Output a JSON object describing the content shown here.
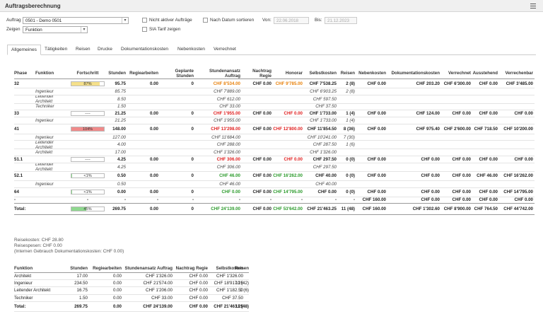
{
  "window": {
    "title": "Auftragsberechnung",
    "menu_icon": "hamburger-icon"
  },
  "filters": {
    "auftrag_label": "Auftrag",
    "auftrag_value": "0501 - Demo 0501",
    "zeigen_label": "Zeigen",
    "zeigen_value": "Funktion",
    "nicht_aktiver_label": "Nicht aktiver Aufträge",
    "sia_tarif_label": "SIA Tarif zeigen",
    "nach_datum_label": "Nach Datum sortieren",
    "von_label": "Von:",
    "von_value": "22.06.2018",
    "bis_label": "Bis:",
    "bis_value": "21.12.2023"
  },
  "tabs": [
    "Allgemeines",
    "Tätigkeiten",
    "Reisen",
    "Drucke",
    "Dokumentationskosten",
    "Nebenkosten",
    "Verrechnet"
  ],
  "main_table": {
    "headers": [
      "Phase",
      "Funktion",
      "Fortschritt",
      "Stunden",
      "Regiearbeiten",
      "Geplante Stunden",
      "Stundenansatz Auftrag",
      "Nachtrag Regie",
      "Honorar",
      "Selbstkosten",
      "Reisen",
      "Nebenkosten",
      "Dokumentationskosten",
      "Verrechnet",
      "Ausstehend",
      "Verrechenbar"
    ],
    "rows": [
      {
        "type": "phase",
        "phase": "32",
        "progress_label": "87%",
        "progress": 0.87,
        "bar_color": "#f5e08a",
        "stunden": "95.75",
        "regie": "0.00",
        "geplant": "0",
        "ansatz": "CHF 8'534.00",
        "ansatz_color": "orange",
        "nachtrag": "CHF 0.00",
        "honorar": "CHF 9'785.00",
        "honorar_color": "orange",
        "selbst": "CHF 7'538.25",
        "reisen": "2 (8)",
        "neben": "CHF 0.00",
        "doku": "CHF 203.20",
        "verr": "CHF 6'300.00",
        "aus": "CHF 0.00",
        "verrb": "CHF 3'485.00",
        "verrb_color": ""
      },
      {
        "type": "sub",
        "funktion": "Ingenieur",
        "stunden": "85.75",
        "ansatz": "CHF 7'889.00",
        "selbst": "CHF 6'903.25",
        "reisen": "2 (8)"
      },
      {
        "type": "sub",
        "funktion": "Leitender Architekt",
        "stunden": "8.50",
        "ansatz": "CHF 612.00",
        "selbst": "CHF 597.50",
        "reisen": ""
      },
      {
        "type": "sub",
        "funktion": "Techniker",
        "stunden": "1.50",
        "ansatz": "CHF 33.00",
        "selbst": "CHF 37.50",
        "reisen": ""
      },
      {
        "type": "phase",
        "phase": "33",
        "progress_label": "----",
        "progress": 0,
        "bar_color": "#ffffff",
        "stunden": "21.25",
        "regie": "0.00",
        "geplant": "0",
        "ansatz": "CHF 1'955.00",
        "ansatz_color": "red",
        "nachtrag": "CHF 0.00",
        "honorar": "CHF 0.00",
        "honorar_color": "red",
        "selbst": "CHF 1'733.00",
        "reisen": "1 (4)",
        "neben": "CHF 0.00",
        "doku": "CHF 124.00",
        "verr": "CHF 0.00",
        "aus": "CHF 0.00",
        "verrb": "CHF 0.00",
        "verrb_color": ""
      },
      {
        "type": "sub",
        "funktion": "Ingenieur",
        "stunden": "21.25",
        "ansatz": "CHF 1'955.00",
        "selbst": "CHF 1'733.00",
        "reisen": "1 (4)"
      },
      {
        "type": "phase",
        "phase": "41",
        "progress_label": "104%",
        "progress": 1,
        "bar_color": "#f08a8a",
        "stunden": "148.00",
        "regie": "0.00",
        "geplant": "0",
        "ansatz": "CHF 13'298.00",
        "ansatz_color": "red",
        "nachtrag": "CHF 0.00",
        "honorar": "CHF 12'800.00",
        "honorar_color": "red",
        "selbst": "CHF 11'854.50",
        "reisen": "8 (36)",
        "neben": "CHF 0.00",
        "doku": "CHF 975.40",
        "verr": "CHF 2'600.00",
        "aus": "CHF 718.50",
        "verrb": "CHF 10'200.00",
        "verrb_color": ""
      },
      {
        "type": "sub",
        "funktion": "Ingenieur",
        "stunden": "127.00",
        "ansatz": "CHF 11'684.00",
        "selbst": "CHF 10'241.00",
        "reisen": "7 (30)"
      },
      {
        "type": "sub",
        "funktion": "Leitender Architekt",
        "stunden": "4.00",
        "ansatz": "CHF 288.00",
        "selbst": "CHF 287.50",
        "reisen": "1 (6)"
      },
      {
        "type": "sub",
        "funktion": "Architekt",
        "stunden": "17.00",
        "ansatz": "CHF 1'326.00",
        "selbst": "CHF 1'326.00",
        "reisen": ""
      },
      {
        "type": "phase",
        "phase": "51.1",
        "progress_label": "----",
        "progress": 0,
        "bar_color": "#ffffff",
        "stunden": "4.25",
        "regie": "0.00",
        "geplant": "0",
        "ansatz": "CHF 306.00",
        "ansatz_color": "red",
        "nachtrag": "CHF 0.00",
        "honorar": "CHF 0.00",
        "honorar_color": "red",
        "selbst": "CHF 297.50",
        "reisen": "0 (0)",
        "neben": "CHF 0.00",
        "doku": "CHF 0.00",
        "verr": "CHF 0.00",
        "aus": "CHF 0.00",
        "verrb": "CHF 0.00",
        "verrb_color": ""
      },
      {
        "type": "sub",
        "funktion": "Leitender Architekt",
        "stunden": "4.25",
        "ansatz": "CHF 306.00",
        "selbst": "CHF 297.50",
        "reisen": ""
      },
      {
        "type": "phase",
        "phase": "52.1",
        "progress_label": "<1%",
        "progress": 0.01,
        "bar_color": "#8fd88f",
        "stunden": "0.50",
        "regie": "0.00",
        "geplant": "0",
        "ansatz": "CHF 46.00",
        "ansatz_color": "green",
        "nachtrag": "CHF 0.00",
        "honorar": "CHF 16'262.00",
        "honorar_color": "green",
        "selbst": "CHF 40.00",
        "reisen": "0 (0)",
        "neben": "CHF 0.00",
        "doku": "CHF 0.00",
        "verr": "CHF 0.00",
        "aus": "CHF 46.00",
        "verrb": "CHF 16'262.00",
        "verrb_color": ""
      },
      {
        "type": "sub",
        "funktion": "Ingenieur",
        "stunden": "0.50",
        "ansatz": "CHF 46.00",
        "selbst": "CHF 40.00",
        "reisen": ""
      },
      {
        "type": "phase",
        "phase": "64",
        "progress_label": "<1%",
        "progress": 0.01,
        "bar_color": "#8fd88f",
        "stunden": "0.00",
        "regie": "0.00",
        "geplant": "0",
        "ansatz": "CHF 0.00",
        "ansatz_color": "green",
        "nachtrag": "CHF 0.00",
        "honorar": "CHF 14'795.00",
        "honorar_color": "green",
        "selbst": "CHF 0.00",
        "reisen": "0 (0)",
        "neben": "CHF 0.00",
        "doku": "CHF 0.00",
        "verr": "CHF 0.00",
        "aus": "CHF 0.00",
        "verrb": "CHF 14'795.00",
        "verrb_color": ""
      },
      {
        "type": "dash",
        "phase": "-",
        "progress_label": "-",
        "stunden": "-",
        "regie": "-",
        "geplant": "-",
        "ansatz": "-",
        "nachtrag": "-",
        "honorar": "-",
        "selbst": "-",
        "reisen": "-",
        "neben": "CHF 160.00",
        "doku": "CHF 0.00",
        "verr": "CHF 0.00",
        "aus": "CHF 0.00",
        "verrb": "CHF 0.00"
      }
    ],
    "total": {
      "label": "Total:",
      "progress_label": "45%",
      "progress": 0.45,
      "stunden": "269.75",
      "regie": "0.00",
      "geplant": "0",
      "ansatz": "CHF 24'139.00",
      "nachtrag": "CHF 0.00",
      "honorar": "CHF 53'642.00",
      "selbst": "CHF 21'463.25",
      "reisen": "11 (48)",
      "neben": "CHF 160.00",
      "doku": "CHF 1'302.60",
      "verr": "CHF 8'900.00",
      "aus": "CHF 764.50",
      "verrb": "CHF 44'742.00"
    }
  },
  "notes": {
    "line1": "Reisekosten: CHF 28.80",
    "line2": "Reisespesen: CHF 0.00",
    "line3": "(Internen Gebrauch Dokumentationskosten: CHF 0.00)"
  },
  "summary_table": {
    "headers": [
      "Funktion",
      "Stunden",
      "Regiearbeiten",
      "Stundenansatz Auftrag",
      "Nachtrag Regie",
      "Selbstkosten",
      "Reisen"
    ],
    "rows": [
      [
        "Architekt",
        "17.00",
        "0.00",
        "CHF 1'326.00",
        "CHF 0.00",
        "CHF 1'326.00",
        ""
      ],
      [
        "Ingenieur",
        "234.50",
        "0.00",
        "CHF 21'574.00",
        "CHF 0.00",
        "CHF 18'917.25",
        "10 (42)"
      ],
      [
        "Leitender Architekt",
        "16.75",
        "0.00",
        "CHF 1'206.00",
        "CHF 0.00",
        "CHF 1'182.50",
        "1 (6)"
      ],
      [
        "Techniker",
        "1.50",
        "0.00",
        "CHF 33.00",
        "CHF 0.00",
        "CHF 37.50",
        ""
      ]
    ],
    "total": [
      "Total:",
      "269.75",
      "0.00",
      "CHF 24'139.00",
      "CHF 0.00",
      "CHF 21'463.25",
      "11 (48)"
    ]
  }
}
